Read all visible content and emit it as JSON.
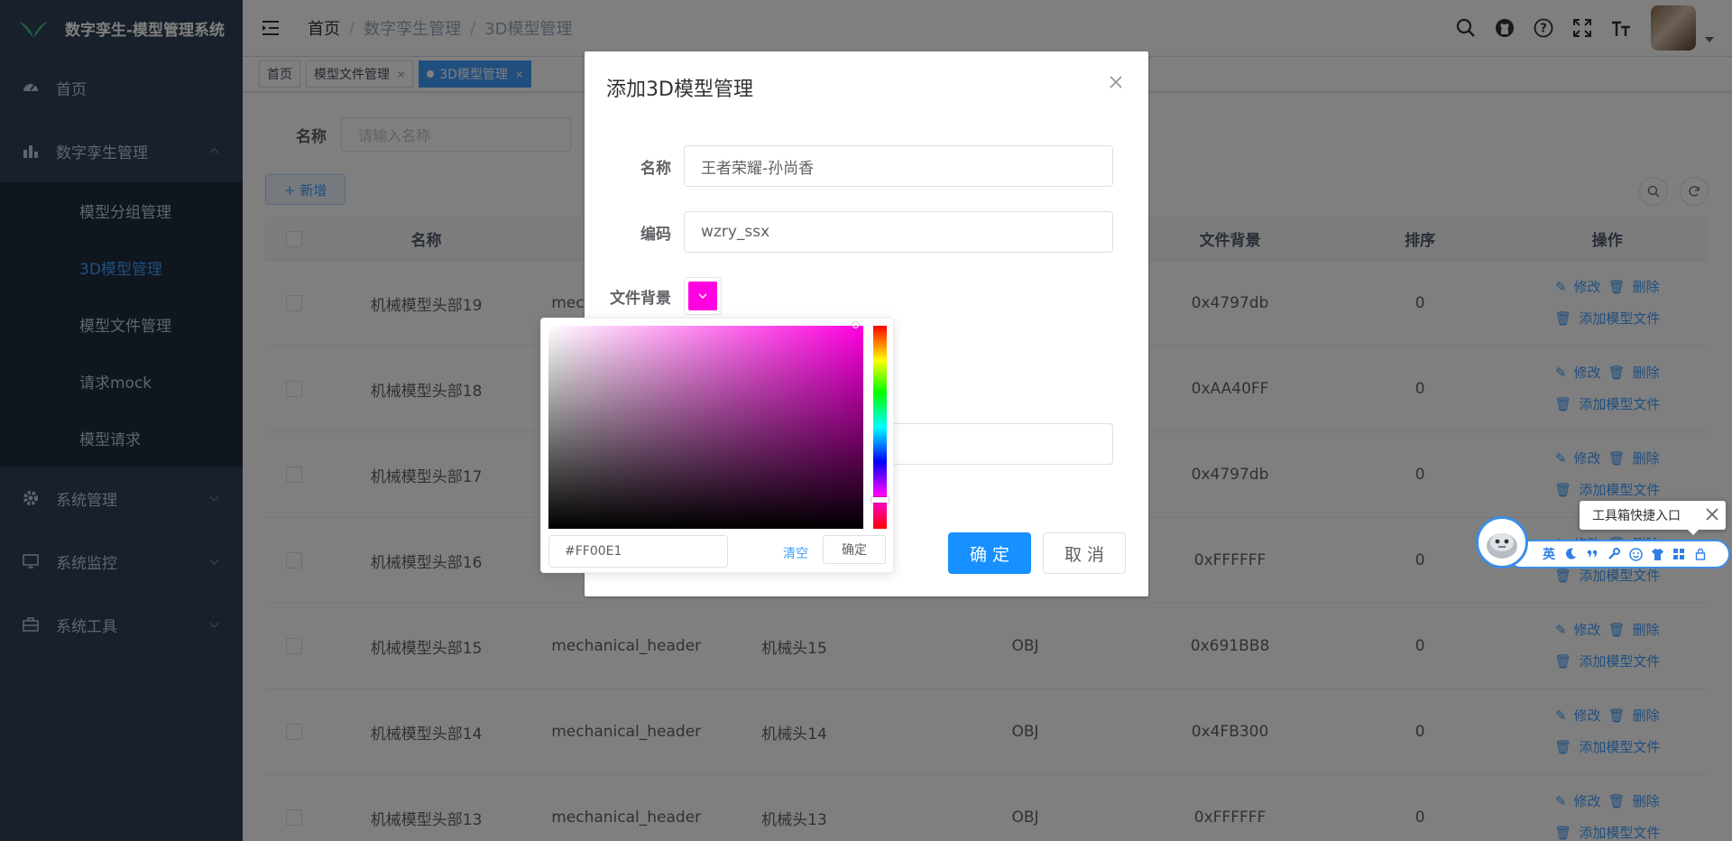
{
  "app": {
    "title": "数字孪生-模型管理系统"
  },
  "sidebar": {
    "items": [
      {
        "label": "首页"
      },
      {
        "label": "数字孪生管理"
      },
      {
        "label": "系统管理"
      },
      {
        "label": "系统监控"
      },
      {
        "label": "系统工具"
      }
    ],
    "subitems": [
      {
        "label": "模型分组管理"
      },
      {
        "label": "3D模型管理"
      },
      {
        "label": "模型文件管理"
      },
      {
        "label": "请求mock"
      },
      {
        "label": "模型请求"
      }
    ]
  },
  "breadcrumb": [
    "首页",
    "数字孪生管理",
    "3D模型管理"
  ],
  "tags": [
    "首页",
    "模型文件管理",
    "3D模型管理"
  ],
  "search": {
    "label": "名称",
    "placeholder": "请输入名称"
  },
  "toolbar": {
    "add_label": "+ 新增"
  },
  "table": {
    "headers": [
      "名称",
      "文件背景",
      "排序",
      "操作"
    ],
    "ops": {
      "edit": "修改",
      "delete": "删除",
      "add_file": "添加模型文件"
    },
    "rows": [
      {
        "name": "机械模型头部19",
        "code": "mec",
        "group": "",
        "type": "",
        "bg": "0x4797db",
        "sort": "0"
      },
      {
        "name": "机械模型头部18",
        "code": "",
        "group": "",
        "type": "",
        "bg": "0xAA40FF",
        "sort": "0"
      },
      {
        "name": "机械模型头部17",
        "code": "",
        "group": "",
        "type": "",
        "bg": "0x4797db",
        "sort": "0"
      },
      {
        "name": "机械模型头部16",
        "code": "",
        "group": "",
        "type": "",
        "bg": "0xFFFFFF",
        "sort": "0"
      },
      {
        "name": "机械模型头部15",
        "code": "mechanical_header",
        "group": "机械头15",
        "type": "OBJ",
        "bg": "0x691BB8",
        "sort": "0"
      },
      {
        "name": "机械模型头部14",
        "code": "mechanical_header",
        "group": "机械头14",
        "type": "OBJ",
        "bg": "0x4FB300",
        "sort": "0"
      },
      {
        "name": "机械模型头部13",
        "code": "mechanical_header",
        "group": "机械头13",
        "type": "OBJ",
        "bg": "0xFFFFFF",
        "sort": "0"
      }
    ]
  },
  "dialog": {
    "title": "添加3D模型管理",
    "name_label": "名称",
    "name_value": "王者荣耀-孙尚香",
    "code_label": "编码",
    "code_value": "wzry_ssx",
    "bg_label": "文件背景",
    "confirm": "确 定",
    "cancel": "取 消"
  },
  "color_picker": {
    "hex_value": "#FF00E1",
    "clear": "清空",
    "ok": "确定",
    "selected_color": "#ff00e1"
  },
  "toolbox": {
    "tip": "工具箱快捷入口",
    "lang": "英"
  }
}
